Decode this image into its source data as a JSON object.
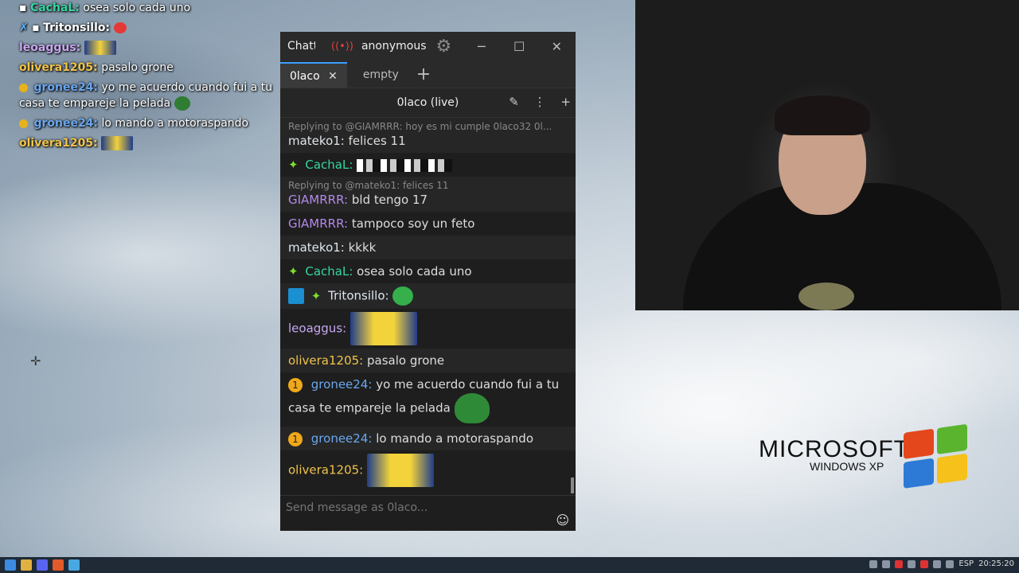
{
  "overlay_chat": [
    {
      "user": "CachaL:",
      "text": "osea solo cada uno",
      "color": "#35d6a0"
    },
    {
      "user": "Tritonsillo:",
      "text": "",
      "color": "#ffffff"
    },
    {
      "user": "leoaggus:",
      "text": "",
      "color": "#c8a8f0"
    },
    {
      "user": "olivera1205:",
      "text": "pasalo grone",
      "color": "#f0c34a"
    },
    {
      "user": "gronee24:",
      "text": "yo me acuerdo cuando fui a tu casa te empareje la pelada",
      "color": "#6aa7ef"
    },
    {
      "user": "gronee24:",
      "text": "lo mando a motoraspando",
      "color": "#6aa7ef"
    },
    {
      "user": "olivera1205:",
      "text": "",
      "color": "#f0c34a"
    }
  ],
  "window": {
    "app_title": "Chatte",
    "live_icon": "((•))",
    "account": "anonymous",
    "minimize": "─",
    "maximize": "☐",
    "close": "✕"
  },
  "tabs": [
    {
      "label": "0laco",
      "close": "✕",
      "active": true
    },
    {
      "label": "empty",
      "active": false
    }
  ],
  "tab_add": "+",
  "split_header": {
    "title": "0laco (live)",
    "moderation_icon": "✎",
    "more_icon": "⋮",
    "add_icon": "+"
  },
  "messages": [
    {
      "reply": "Replying to @GIAMRRR: hoy es mi cumple 0laco32 0l...",
      "user": "mateko1:",
      "text": "felices 11",
      "color": "#dfe6ee"
    },
    {
      "badge": "✦",
      "user": "CachaL:",
      "text": "",
      "color": "#35d6a0"
    },
    {
      "reply": "Replying to @mateko1: felices 11",
      "user": "GIAMRRR:",
      "text": "bld tengo 17",
      "color": "#b489e8"
    },
    {
      "user": "GIAMRRR:",
      "text": "tampoco soy un feto",
      "color": "#b489e8"
    },
    {
      "user": "mateko1:",
      "text": "kkkk",
      "color": "#dfe6ee"
    },
    {
      "badge": "✦",
      "user": "CachaL:",
      "text": "osea solo cada uno",
      "color": "#35d6a0"
    },
    {
      "badge": "✦",
      "user": "Tritonsillo:",
      "text": "",
      "color": "#ffffff"
    },
    {
      "user": "leoaggus:",
      "text": "",
      "color": "#c8a8f0"
    },
    {
      "user": "olivera1205:",
      "text": "pasalo grone",
      "color": "#f0c34a"
    },
    {
      "badge": "1",
      "user": "gronee24:",
      "text": "yo me acuerdo cuando fui a tu casa te empareje la pelada",
      "color": "#6aa7ef"
    },
    {
      "badge": "1",
      "user": "gronee24:",
      "text": "lo mando a motoraspando",
      "color": "#6aa7ef"
    },
    {
      "user": "olivera1205:",
      "text": "",
      "color": "#f0c34a"
    }
  ],
  "input": {
    "placeholder": "Send message as 0laco...",
    "emoji_icon": "☺"
  },
  "desktop": {
    "brand": "MICROSOFT",
    "product": "WINDOWS XP"
  },
  "taskbar": {
    "lang": "ESP",
    "time": "20:25:20"
  }
}
